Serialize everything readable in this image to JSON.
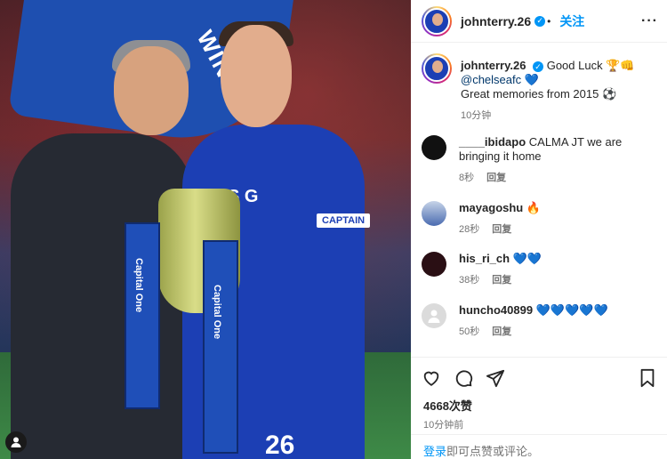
{
  "header": {
    "username": "johnterry.26",
    "follow_label": "关注",
    "more_label": "···"
  },
  "photo": {
    "banner_text": "WINN",
    "sponsor_text": "SMS G",
    "armband_text": "CAPTAIN",
    "kit_number": "26",
    "ribbon_text": "Capital One"
  },
  "caption": {
    "username": "johnterry.26",
    "text_intro": "Good Luck",
    "emoji_intro": "🏆👊",
    "mention": "@chelseafc",
    "heart": "💙",
    "line2": "Great memories from 2015 ⚽",
    "time": "10分钟"
  },
  "comments": [
    {
      "username": "____ibidapo",
      "text": "CALMA JT we are bringing it home",
      "time": "8秒",
      "reply": "回复"
    },
    {
      "username": "mayagoshu",
      "text": "🔥",
      "time": "28秒",
      "reply": "回复"
    },
    {
      "username": "his_ri_ch",
      "text": "💙💙",
      "time": "38秒",
      "reply": "回复"
    },
    {
      "username": "huncho40899",
      "text": "💙💙💙💙💙",
      "time": "50秒",
      "reply": "回复"
    }
  ],
  "footer": {
    "likes": "4668次赞",
    "posted": "10分钟前",
    "login_link": "登录",
    "login_text": "即可点赞或评论。"
  },
  "colors": {
    "accent": "#0095f6",
    "chelsea_blue": "#1c3fb4"
  }
}
